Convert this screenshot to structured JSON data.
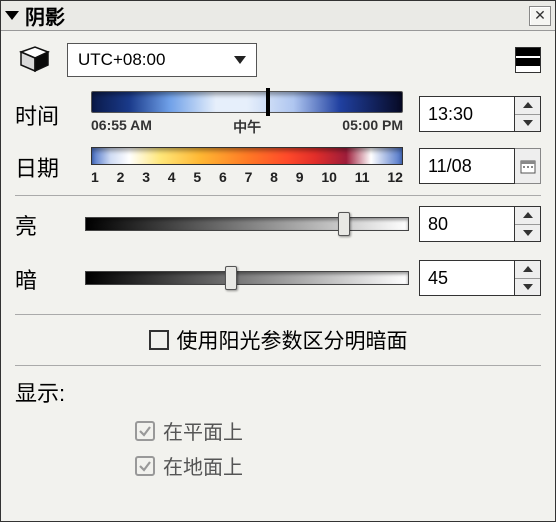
{
  "title": "阴影",
  "timezone": {
    "selected": "UTC+08:00"
  },
  "time": {
    "label": "时间",
    "sunrise": "06:55 AM",
    "noon": "中午",
    "sunset": "05:00 PM",
    "value": "13:30"
  },
  "date": {
    "label": "日期",
    "ticks": [
      "1",
      "2",
      "3",
      "4",
      "5",
      "6",
      "7",
      "8",
      "9",
      "10",
      "11",
      "12"
    ],
    "value": "11/08"
  },
  "light": {
    "label": "亮",
    "value": "80",
    "pos": 80
  },
  "dark": {
    "label": "暗",
    "value": "45",
    "pos": 45
  },
  "sunlight_checkbox": "使用阳光参数区分明暗面",
  "display": {
    "label": "显示:",
    "opt1": "在平面上",
    "opt2": "在地面上"
  }
}
